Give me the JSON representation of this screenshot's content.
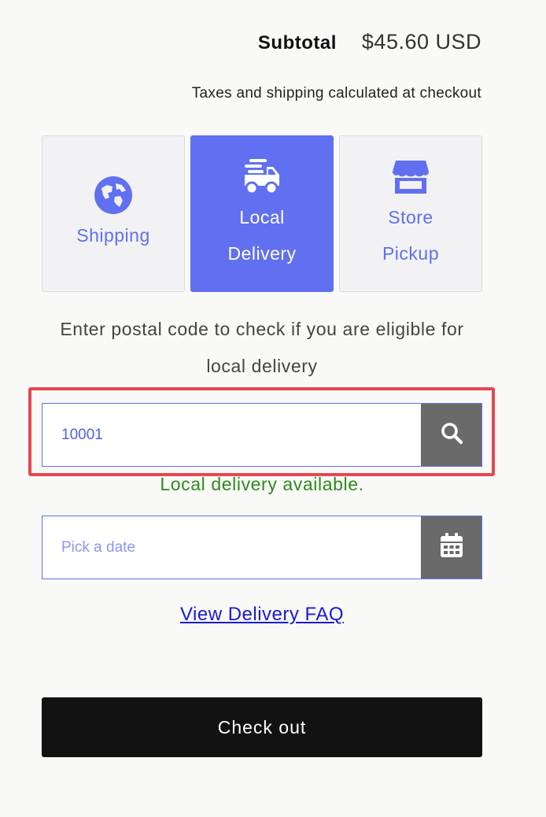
{
  "summary": {
    "subtotal_label": "Subtotal",
    "subtotal_value": "$45.60 USD",
    "taxes_note": "Taxes and shipping calculated at checkout"
  },
  "delivery_methods": [
    {
      "line1": "Shipping",
      "line2": "",
      "icon": "globe-icon",
      "selected": false
    },
    {
      "line1": "Local",
      "line2": "Delivery",
      "icon": "delivery-truck-icon",
      "selected": true
    },
    {
      "line1": "Store",
      "line2": "Pickup",
      "icon": "storefront-icon",
      "selected": false
    }
  ],
  "postal": {
    "hint": "Enter postal code to check if you are eligible for local delivery",
    "value": "10001",
    "button_icon": "search-icon",
    "availability": "Local delivery available."
  },
  "date": {
    "placeholder": "Pick a date",
    "button_icon": "calendar-icon"
  },
  "faq_link": "View Delivery FAQ",
  "checkout_label": "Check out",
  "colors": {
    "accent": "#6070f0",
    "success": "#2e8a1e",
    "highlight": "#e5474f",
    "checkout_bg": "#121212"
  }
}
